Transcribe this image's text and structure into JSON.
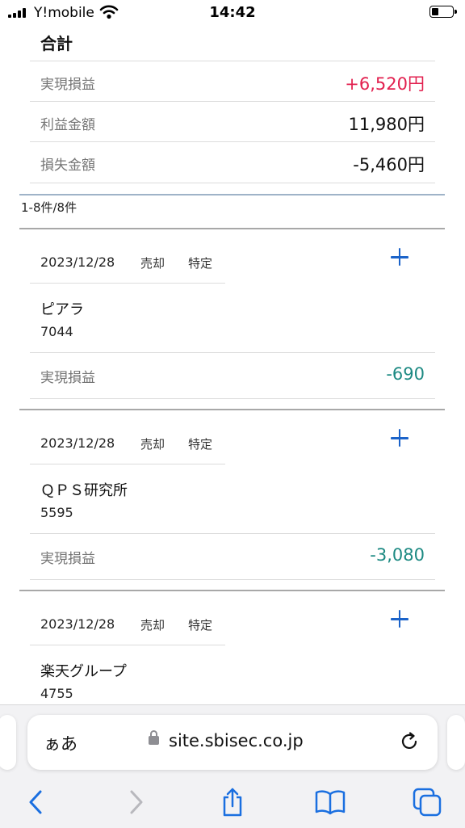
{
  "status_bar": {
    "carrier": "Y!mobile",
    "time": "14:42"
  },
  "summary": {
    "title": "合計",
    "rows": [
      {
        "label": "実現損益",
        "value": "+6,520円"
      },
      {
        "label": "利益金額",
        "value": "11,980円"
      },
      {
        "label": "損失金額",
        "value": "-5,460円"
      }
    ]
  },
  "result_count": "1-8件/8件",
  "trades": [
    {
      "date": "2023/12/28",
      "trade_type": "売却",
      "account": "特定",
      "name": "ピアラ",
      "code": "7044",
      "pl_label": "実現損益",
      "pl_value": "-690"
    },
    {
      "date": "2023/12/28",
      "trade_type": "売却",
      "account": "特定",
      "name": "ＱＰＳ研究所",
      "code": "5595",
      "pl_label": "実現損益",
      "pl_value": "-3,080"
    },
    {
      "date": "2023/12/28",
      "trade_type": "売却",
      "account": "特定",
      "name": "楽天グループ",
      "code": "4755"
    }
  ],
  "browser": {
    "text_size_button": "ぁあ",
    "url": "site.sbisec.co.jp"
  },
  "colors": {
    "profit_positive": "#e2204f",
    "profit_negative": "#1d8a83",
    "accent": "#1b63c9",
    "toolbar_icon": "#1a6fe0"
  },
  "icons": {
    "status": [
      "signal-icon",
      "wifi-icon",
      "battery-icon"
    ],
    "toolbar": [
      "back-icon",
      "forward-icon",
      "share-icon",
      "bookmarks-icon",
      "tabs-icon"
    ]
  }
}
